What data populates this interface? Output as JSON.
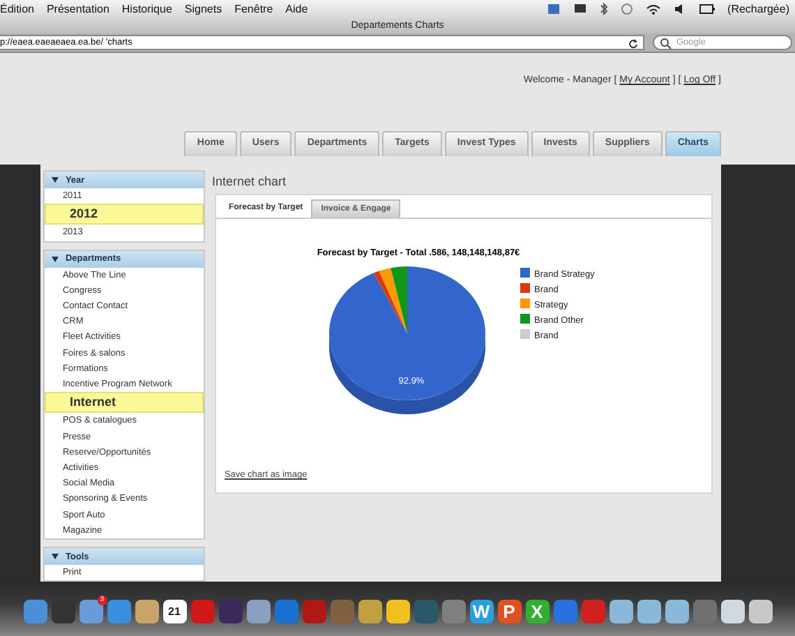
{
  "menu_bar": {
    "items": [
      "Édition",
      "Présentation",
      "Historique",
      "Signets",
      "Fenêtre",
      "Aide"
    ],
    "battery_status": "(Rechargée)"
  },
  "window": {
    "title": "Departements Charts"
  },
  "address_bar": {
    "url": "p://eaea.eaeaeaea.ea.be/  'charts",
    "search_placeholder": "Google"
  },
  "header": {
    "welcome": "Welcome - Manager [",
    "my_account": "My Account",
    "separator": "] [",
    "log_off": "Log Off",
    "end": "]"
  },
  "nav_tabs": [
    {
      "label": "Home",
      "selected": false
    },
    {
      "label": "Users",
      "selected": false
    },
    {
      "label": "Departments",
      "selected": false
    },
    {
      "label": "Targets",
      "selected": false
    },
    {
      "label": "Invest Types",
      "selected": false
    },
    {
      "label": "Invests",
      "selected": false
    },
    {
      "label": "Suppliers",
      "selected": false
    },
    {
      "label": "Charts",
      "selected": true
    }
  ],
  "sidebar": [
    {
      "title": "Year",
      "items": [
        {
          "label": "2011",
          "selected": false
        },
        {
          "label": "2012",
          "selected": true
        },
        {
          "label": "2013",
          "selected": false
        }
      ]
    },
    {
      "title": "Departments",
      "items": [
        {
          "label": "Above The Line",
          "selected": false
        },
        {
          "label": "Congress",
          "selected": false
        },
        {
          "label": "Contact Contact",
          "selected": false
        },
        {
          "label": "CRM",
          "selected": false
        },
        {
          "label": "Fleet Activities",
          "selected": false
        },
        {
          "label": "Foires & salons",
          "selected": false
        },
        {
          "label": "Formations",
          "selected": false
        },
        {
          "label": "Incentive Program Network",
          "selected": false
        },
        {
          "label": "Internet",
          "selected": true
        },
        {
          "label": "POS & catalogues",
          "selected": false
        },
        {
          "label": "Presse",
          "selected": false
        },
        {
          "label": "Reserve/Opportunités",
          "selected": false
        },
        {
          "label": "Activities",
          "selected": false
        },
        {
          "label": "Social Media",
          "selected": false
        },
        {
          "label": "Sponsoring & Events",
          "selected": false
        },
        {
          "label": "Sport Auto",
          "selected": false
        },
        {
          "label": "Magazine",
          "selected": false
        }
      ]
    },
    {
      "title": "Tools",
      "items": [
        {
          "label": "Print",
          "selected": false
        }
      ]
    }
  ],
  "content": {
    "title": "Internet chart",
    "tabs": [
      {
        "label": "Forecast by Target",
        "selected": true
      },
      {
        "label": "Invoice & Engage",
        "selected": false
      }
    ],
    "chart_title": "Forecast by Target - Total .586, 148,148,148,87€",
    "slice_label": "92.9%",
    "legend": [
      {
        "label": "Brand Strategy",
        "color": "#3366cc"
      },
      {
        "label": "Brand",
        "color": "#dc3912"
      },
      {
        "label": "Strategy",
        "color": "#ff9900"
      },
      {
        "label": "Brand  Other",
        "color": "#109618"
      },
      {
        "label": "Brand",
        "color": "#cccccc"
      }
    ],
    "save_link": "Save chart as image"
  },
  "dock": [
    {
      "kind": "app",
      "color": "#4a8fd8"
    },
    {
      "kind": "app",
      "color": "#333333"
    },
    {
      "kind": "app",
      "color": "#6a9ad8",
      "badge": "3"
    },
    {
      "kind": "app",
      "color": "#3a8ee0"
    },
    {
      "kind": "app",
      "color": "#c9a46a"
    },
    {
      "kind": "calendar",
      "glyph": "21",
      "color": "#ffffff"
    },
    {
      "kind": "app",
      "color": "#d01818"
    },
    {
      "kind": "app",
      "color": "#3a2a5a"
    },
    {
      "kind": "app",
      "color": "#8aa0c0"
    },
    {
      "kind": "app",
      "color": "#1a70d0"
    },
    {
      "kind": "app",
      "color": "#b01818"
    },
    {
      "kind": "app",
      "color": "#806040"
    },
    {
      "kind": "app",
      "color": "#c0a040"
    },
    {
      "kind": "app",
      "color": "#f0c020"
    },
    {
      "kind": "app",
      "color": "#2a5a6a"
    },
    {
      "kind": "app",
      "color": "#808080"
    },
    {
      "kind": "letter",
      "glyph": "W",
      "color": "#2aa0e0"
    },
    {
      "kind": "letter",
      "glyph": "P",
      "color": "#e05020"
    },
    {
      "kind": "letter",
      "glyph": "X",
      "color": "#30b030"
    },
    {
      "kind": "app",
      "color": "#2a70e0"
    },
    {
      "kind": "app",
      "color": "#d02020"
    },
    {
      "kind": "folder",
      "color": "#8ab8d8"
    },
    {
      "kind": "folder",
      "color": "#8ab8d8"
    },
    {
      "kind": "folder",
      "color": "#8ab8d8"
    },
    {
      "kind": "app",
      "color": "#707070"
    },
    {
      "kind": "app",
      "color": "#d0d8e0"
    },
    {
      "kind": "app",
      "color": "#c8c8c8"
    }
  ]
}
